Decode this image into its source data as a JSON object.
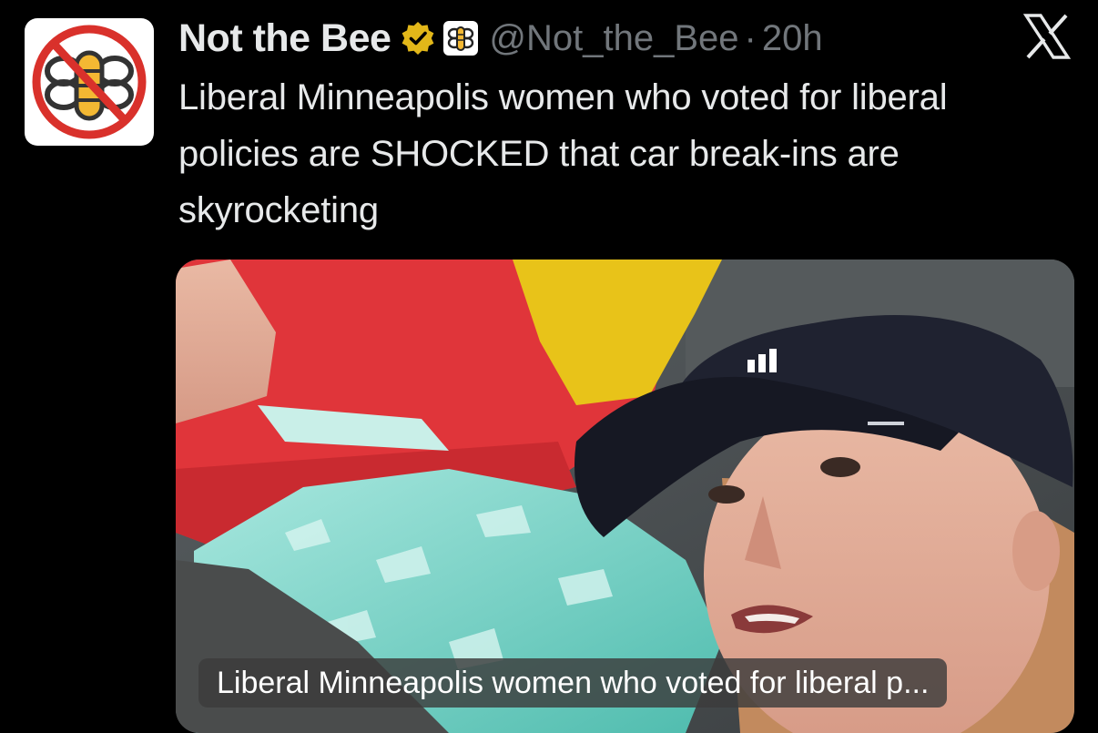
{
  "tweet": {
    "display_name": "Not the Bee",
    "handle": "@Not_the_Bee",
    "separator": "·",
    "time": "20h",
    "text": "Liberal Minneapolis women who voted for liberal policies are SHOCKED that car break-ins are skyrocketing",
    "avatar_icon": "not-the-bee-logo-icon",
    "verified_icon": "gold-verified-badge-icon",
    "affiliate_icon": "bee-affiliate-badge-icon",
    "verified_color": "#e2b719"
  },
  "media": {
    "caption": "Liberal Minneapolis women who voted for liberal p..."
  },
  "app": {
    "logo_icon": "x-logo-icon"
  }
}
